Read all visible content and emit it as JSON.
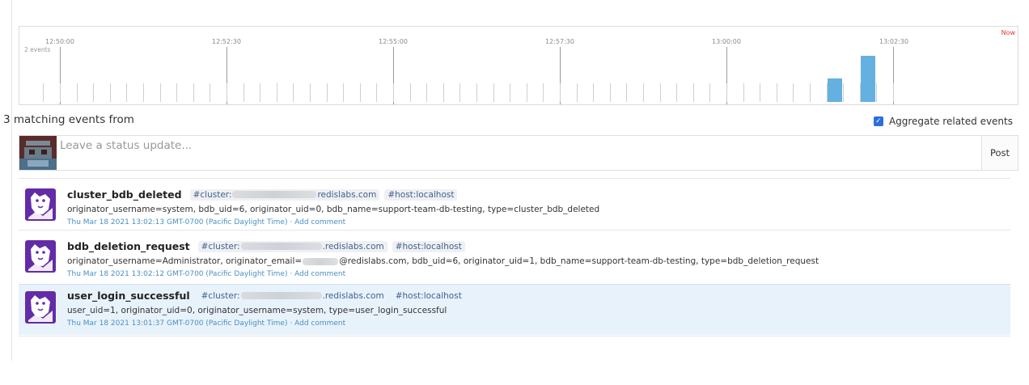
{
  "timeline": {
    "event_count_label": "2 events",
    "now_label": "Now",
    "time_labels": [
      "12:50:00",
      "12:52:30",
      "12:55:00",
      "12:57:30",
      "13:00:00",
      "13:02:30"
    ],
    "bar_color": "#64b1e1",
    "histogram": [
      {
        "time": "13:01:37",
        "events": 1
      },
      {
        "time": "13:02:13",
        "events": 2
      }
    ]
  },
  "results": {
    "title": "3 matching events from",
    "aggregate_label": "Aggregate related events",
    "aggregate_checked": true
  },
  "status": {
    "placeholder": "Leave a status update...",
    "post_label": "Post"
  },
  "events": [
    {
      "name": "cluster_bdb_deleted",
      "cluster_tag_prefix": "#cluster:",
      "cluster_tag_suffix": "redislabs.com",
      "host_tag": "#host:localhost",
      "body_before": "originator_username=system, bdb_uid=6, originator_uid=0, bdb_name=support-team-db-testing, type=cluster_bdb_deleted",
      "body_after": "",
      "timestamp": "Thu Mar 18 2021 13:02:13 GMT-0700 (Pacific Daylight Time)",
      "separator": "·",
      "comment_label": "Add comment"
    },
    {
      "name": "bdb_deletion_request",
      "cluster_tag_prefix": "#cluster:",
      "cluster_tag_suffix": ".redislabs.com",
      "host_tag": "#host:localhost",
      "body_before": "originator_username=Administrator, originator_email=",
      "body_after": "@redislabs.com, bdb_uid=6, originator_uid=1, bdb_name=support-team-db-testing, type=bdb_deletion_request",
      "timestamp": "Thu Mar 18 2021 13:02:12 GMT-0700 (Pacific Daylight Time)",
      "separator": "·",
      "comment_label": "Add comment"
    },
    {
      "name": "user_login_successful",
      "cluster_tag_prefix": "#cluster:",
      "cluster_tag_suffix": ".redislabs.com",
      "host_tag": "#host:localhost",
      "body_before": "user_uid=1, originator_uid=0, originator_username=system, type=user_login_successful",
      "body_after": "",
      "timestamp": "Thu Mar 18 2021 13:01:37 GMT-0700 (Pacific Daylight Time)",
      "separator": "·",
      "comment_label": "Add comment"
    }
  ],
  "colors": {
    "accent": "#2d6fdb",
    "link": "#4a90c2",
    "now": "#e03c31",
    "highlight_row": "#e8f2fb",
    "avatar_purple": "#632ca6"
  },
  "icons": {
    "event_avatar": "datadog-dog-icon",
    "status_avatar": "user-avatar"
  }
}
